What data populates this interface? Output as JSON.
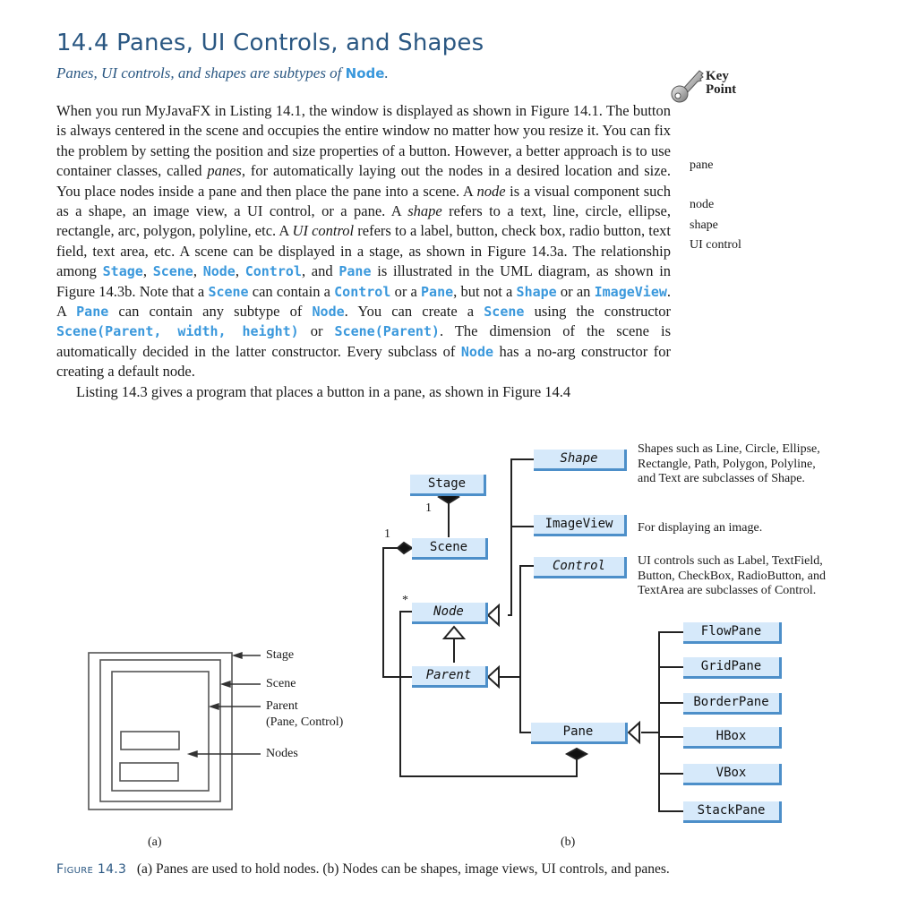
{
  "section": {
    "title": "14.4  Panes, UI Controls, and Shapes",
    "subtitle_prefix": "Panes, UI controls, and shapes are subtypes of ",
    "subtitle_code": "Node",
    "subtitle_suffix": "."
  },
  "key_point": {
    "icon": "key-icon",
    "line1": "Key",
    "line2": "Point"
  },
  "margin_terms": [
    "pane",
    "node",
    "shape",
    "UI control"
  ],
  "paragraph1": {
    "t1": "When you run MyJavaFX in Listing 14.1, the window is displayed as shown in Figure 14.1. The button is always centered in the scene and occupies the entire window no matter how you resize it. You can fix the problem by setting the position and size properties of a button. However, a better approach is to use container classes, called ",
    "panes": "panes",
    "t2": ", for automatically laying out the nodes in a desired location and size. You place nodes inside a pane and then place the pane into a scene. A ",
    "node": "node",
    "t3": " is a visual component such as a shape, an image view, a UI control, or a pane. A ",
    "shape": "shape",
    "t4": " refers to a text, line, circle, ellipse, rectangle, arc, polygon, polyline, etc. A ",
    "ui_control": "UI control",
    "t5": " refers to a label, button, check box, radio button, text field, text area, etc. A scene can be displayed in a stage, as shown in Figure 14.3a. The relationship among ",
    "c_stage": "Stage",
    "t6": ", ",
    "c_scene": "Scene",
    "t7": ", ",
    "c_node": "Node",
    "t8": ", ",
    "c_control": "Control",
    "t9": ", and ",
    "c_pane": "Pane",
    "t10": " is illustrated in the UML diagram, as shown in Figure 14.3b. Note that a ",
    "c_scene2": "Scene",
    "t11": " can contain a ",
    "c_control2": "Control",
    "t12": " or a ",
    "c_pane2": "Pane",
    "t13": ", but not a ",
    "c_shape": "Shape",
    "t14": " or an ",
    "c_imageview": "ImageView",
    "t15": ". A ",
    "c_pane3": "Pane",
    "t16": " can contain any subtype of ",
    "c_node2": "Node",
    "t17": ". You can create a ",
    "c_scene3": "Scene",
    "t18": " using the constructor ",
    "c_ctor1": "Scene(Parent, width, height)",
    "t19": " or ",
    "c_ctor2": "Scene(Parent)",
    "t20": ". The dimension of the scene is automatically decided in the latter constructor. Every subclass of ",
    "c_node3": "Node",
    "t21": " has a no-arg constructor for creating a default node."
  },
  "paragraph2": "Listing 14.3 gives a program that places a button in a pane, as shown in Figure 14.4",
  "figure_a": {
    "labels": [
      "Stage",
      "Scene",
      "Parent",
      "(Pane, Control)",
      "Nodes"
    ],
    "sublabel": "(a)"
  },
  "figure_b": {
    "sublabel": "(b)",
    "classes": {
      "stage": "Stage",
      "scene": "Scene",
      "node": "Node",
      "parent": "Parent",
      "shape": "Shape",
      "imageview": "ImageView",
      "control": "Control",
      "pane": "Pane",
      "flowpane": "FlowPane",
      "gridpane": "GridPane",
      "borderpane": "BorderPane",
      "hbox": "HBox",
      "vbox": "VBox",
      "stackpane": "StackPane"
    },
    "multiplicities": {
      "stage_scene": "1",
      "scene_node": "1",
      "node_many": "*"
    },
    "notes": {
      "shape": "Shapes such as Line, Circle, Ellipse, Rectangle, Path, Polygon, Polyline, and Text are subclasses of Shape.",
      "imageview": "For displaying an image.",
      "control": "UI controls such as Label, TextField, Button, CheckBox, RadioButton, and TextArea are subclasses of Control."
    }
  },
  "caption": {
    "label": "Figure 14.3",
    "text": "(a) Panes are used to hold nodes. (b) Nodes can be shapes, image views, UI controls, and panes."
  }
}
